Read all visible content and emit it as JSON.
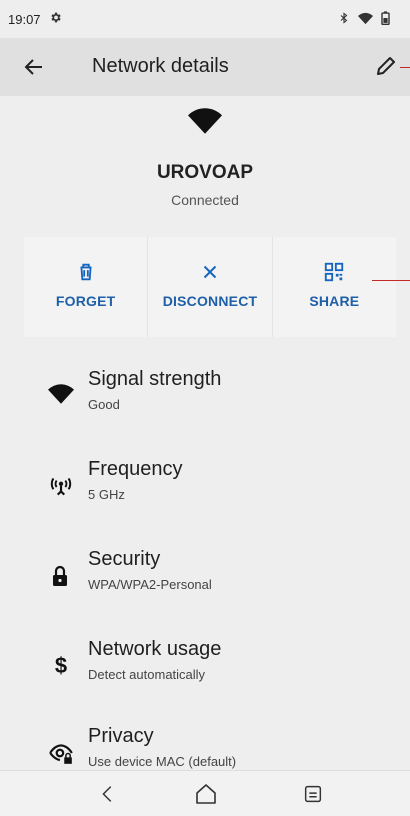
{
  "status_bar": {
    "time": "19:07",
    "icons": [
      "gear-icon",
      "bluetooth-icon",
      "wifi-icon",
      "battery-icon"
    ]
  },
  "app_bar": {
    "title": "Network details",
    "back_icon": "arrow-back-icon",
    "edit_icon": "pencil-icon"
  },
  "network": {
    "ssid": "UROVOAP",
    "status": "Connected"
  },
  "actions": [
    {
      "label": "FORGET",
      "icon": "trash-icon"
    },
    {
      "label": "DISCONNECT",
      "icon": "close-icon"
    },
    {
      "label": "SHARE",
      "icon": "qr-code-icon"
    }
  ],
  "details": [
    {
      "title": "Signal strength",
      "value": "Good",
      "icon": "wifi-icon"
    },
    {
      "title": "Frequency",
      "value": "5 GHz",
      "icon": "antenna-icon"
    },
    {
      "title": "Security",
      "value": "WPA/WPA2-Personal",
      "icon": "lock-icon"
    },
    {
      "title": "Network usage",
      "value": "Detect automatically",
      "icon": "dollar-icon"
    },
    {
      "title": "Privacy",
      "value": "Use device MAC (default)",
      "icon": "eye-lock-icon"
    }
  ],
  "colors": {
    "accent": "#1565c0",
    "background": "#eeeeee",
    "app_bar": "#e0e0e0"
  }
}
